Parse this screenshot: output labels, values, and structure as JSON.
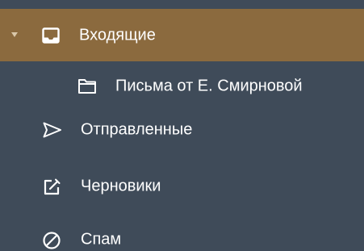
{
  "folders": {
    "inbox": {
      "label": "Входящие",
      "icon": "inbox-icon",
      "expanded": true,
      "selected": true
    },
    "subfolder": {
      "label": "Письма от Е. Смирновой",
      "icon": "folder-icon"
    },
    "sent": {
      "label": "Отправленные",
      "icon": "send-icon"
    },
    "drafts": {
      "label": "Черновики",
      "icon": "edit-icon"
    },
    "spam": {
      "label": "Спам",
      "icon": "block-icon"
    }
  },
  "colors": {
    "background": "#3f4b59",
    "selected": "#8b6a3e",
    "text": "#ffffff",
    "icon": "#ffffff"
  }
}
